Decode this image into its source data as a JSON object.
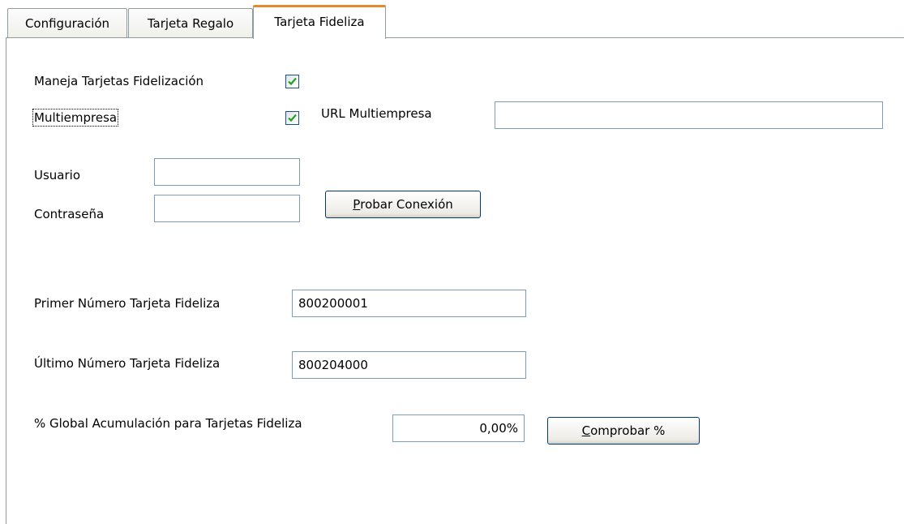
{
  "tabs": [
    {
      "label": "Configuración"
    },
    {
      "label": "Tarjeta Regalo"
    },
    {
      "label": "Tarjeta Fideliza"
    }
  ],
  "form": {
    "maneja_label": "Maneja Tarjetas Fidelización",
    "maneja_checked": true,
    "multiempresa_label": "Multiempresa",
    "multiempresa_checked": true,
    "url_label": "URL Multiempresa",
    "url_value": "",
    "usuario_label": "Usuario",
    "usuario_value": "",
    "password_label": "Contraseña",
    "password_value": "",
    "probar_mnemonic": "P",
    "probar_rest": "robar Conexión",
    "primer_label": "Primer Número Tarjeta Fideliza",
    "primer_value": "800200001",
    "ultimo_label": "Último Número Tarjeta Fideliza",
    "ultimo_value": "800204000",
    "global_label": "% Global Acumulación para Tarjetas Fideliza",
    "global_value": "0,00%",
    "comprobar_mnemonic": "C",
    "comprobar_rest": "omprobar %"
  }
}
